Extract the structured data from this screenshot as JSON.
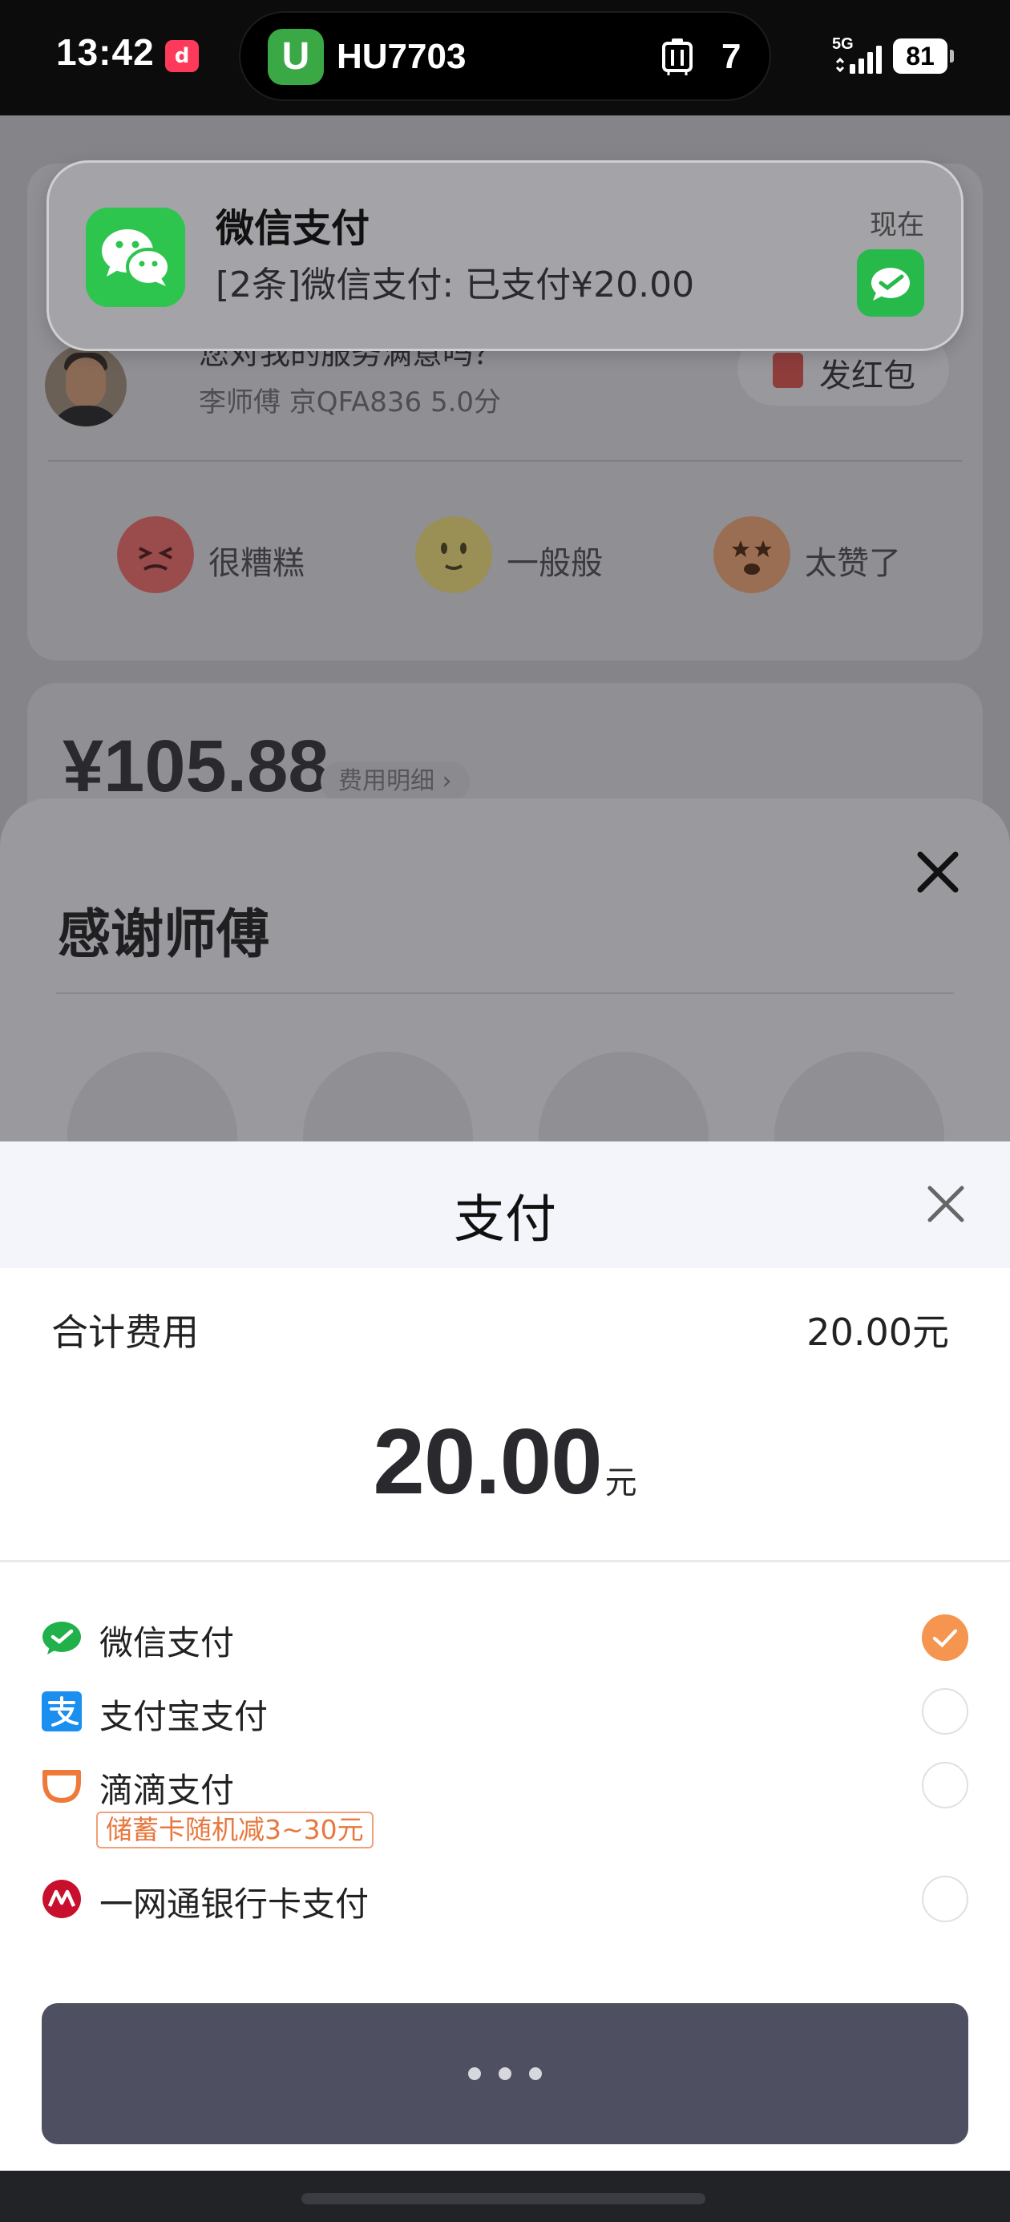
{
  "status_bar": {
    "time": "13:42",
    "notification_app_badge": "d",
    "live_activity": {
      "app_glyph": "U",
      "flight": "HU7703",
      "gate": "7"
    },
    "network": "5G",
    "battery": "81"
  },
  "notification": {
    "app": "微信支付",
    "time": "现在",
    "body": "[2条]微信支付: 已支付¥20.00"
  },
  "background": {
    "question": "您对我的服务满意吗？",
    "driver_info": "李师傅 京QFA836 5.0分",
    "hongbao_label": "发红包",
    "ratings": [
      "很糟糕",
      "一般般",
      "太赞了"
    ],
    "fare": "¥105.88",
    "fare_detail": "费用明细 ›"
  },
  "thank_sheet": {
    "title": "感谢师傅"
  },
  "payment": {
    "title": "支付",
    "total_label": "合计费用",
    "total_value": "20.00元",
    "amount": "20.00",
    "amount_unit": "元",
    "methods": [
      {
        "label": "微信支付",
        "icon": "wechat-pay-icon",
        "selected": true
      },
      {
        "label": "支付宝支付",
        "icon": "alipay-icon",
        "selected": false
      },
      {
        "label": "滴滴支付",
        "icon": "didi-icon",
        "selected": false,
        "promo": "储蓄卡随机减3~30元"
      },
      {
        "label": "一网通银行卡支付",
        "icon": "cmb-icon",
        "selected": false
      }
    ],
    "accent_color": "#f6954f",
    "button_color": "#4e4f60"
  }
}
